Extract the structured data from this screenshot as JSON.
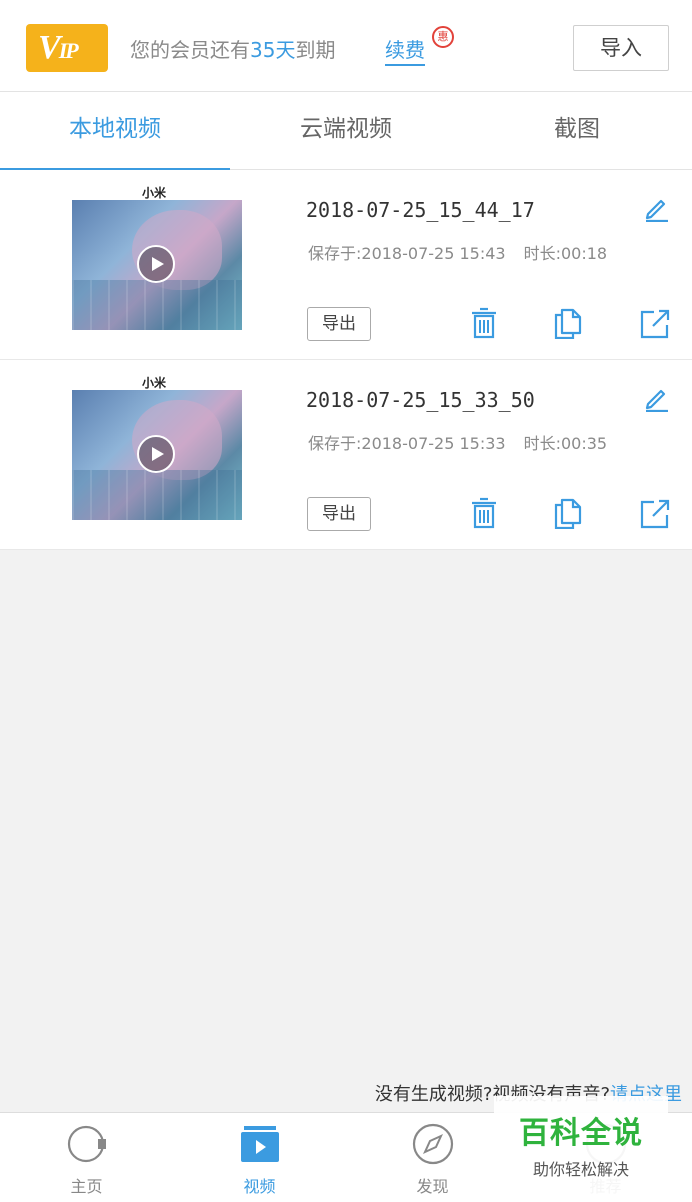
{
  "header": {
    "vip_logo_text": "VIP",
    "member_prefix": "您的会员还有",
    "member_days": "35天",
    "member_suffix": "到期",
    "renew_label": "续费",
    "renew_badge": "惠",
    "import_label": "导入"
  },
  "tabs": [
    {
      "label": "本地视频",
      "active": true
    },
    {
      "label": "云端视频",
      "active": false
    },
    {
      "label": "截图",
      "active": false
    }
  ],
  "videos": [
    {
      "thumb_caption": "小米",
      "title": "2018-07-25_15_44_17",
      "saved": "保存于:2018-07-25 15:43",
      "duration": "时长:00:18",
      "export_label": "导出"
    },
    {
      "thumb_caption": "小米",
      "title": "2018-07-25_15_33_50",
      "saved": "保存于:2018-07-25 15:33",
      "duration": "时长:00:35",
      "export_label": "导出"
    }
  ],
  "hint": {
    "text": "没有生成视频?视频没有声音?",
    "link": "请点这里"
  },
  "bottom_nav": [
    {
      "label": "主页",
      "icon": "home-camera-icon",
      "active": false
    },
    {
      "label": "视频",
      "icon": "video-play-icon",
      "active": true
    },
    {
      "label": "发现",
      "icon": "compass-icon",
      "active": false
    },
    {
      "label": "推荐",
      "icon": "recommend-icon",
      "active": false
    }
  ],
  "watermark": {
    "title": "百科全说",
    "subtitle": "助你轻松解决"
  },
  "colors": {
    "accent": "#3b9be0",
    "vip": "#f5b21b",
    "badge": "#e2423a",
    "watermark": "#2fb33d"
  }
}
